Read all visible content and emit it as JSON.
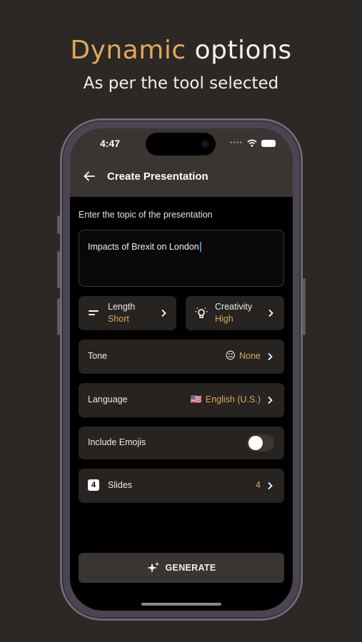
{
  "promo": {
    "headline_accent": "Dynamic",
    "headline_rest": "options",
    "subheadline": "As per the tool selected",
    "accent_color": "#e0a85a"
  },
  "status_bar": {
    "time": "4:47"
  },
  "header": {
    "back_icon": "arrow-left-icon",
    "title": "Create Presentation"
  },
  "topic": {
    "label": "Enter the topic of the presentation",
    "value": "Impacts of Brexit on London"
  },
  "options": {
    "length": {
      "label": "Length",
      "value": "Short",
      "icon": "lines-icon"
    },
    "creativity": {
      "label": "Creativity",
      "value": "High",
      "icon": "bulb-icon"
    },
    "tone": {
      "label": "Tone",
      "emoji": "😐",
      "value": "None"
    },
    "language": {
      "label": "Language",
      "flag": "🇺🇸",
      "value": "English (U.S.)"
    },
    "emojis": {
      "label": "Include Emojis",
      "enabled": false
    },
    "slides": {
      "icon_text": "4",
      "label": "Slides",
      "value": "4"
    }
  },
  "generate_button": {
    "label": "GENERATE",
    "icon": "sparkles-icon"
  }
}
